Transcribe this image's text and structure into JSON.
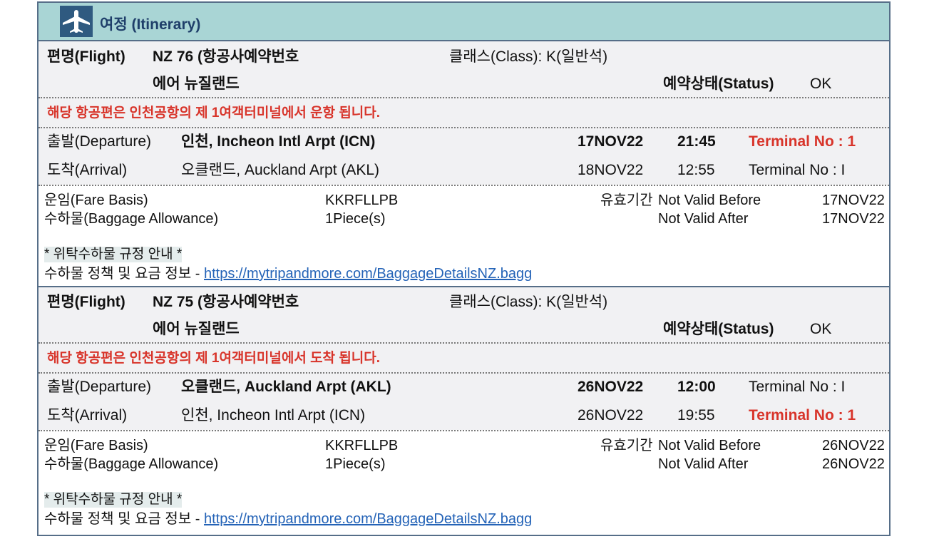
{
  "section": {
    "title": "여정 (Itinerary)",
    "icon": "airplane-icon"
  },
  "colors": {
    "accent": "#d8342a",
    "header_bg": "#a9d5d5",
    "border": "#566e88",
    "link": "#2463b7"
  },
  "labels": {
    "flight": "편명(Flight)",
    "class": "클래스(Class): K(일반석)",
    "status_label": "예약상태(Status)",
    "departure": "출발(Departure)",
    "arrival": "도착(Arrival)",
    "fare_basis": "운임(Fare Basis)",
    "baggage": "수하물(Baggage Allowance)",
    "validity": "유효기간",
    "not_valid_before": "Not Valid Before",
    "not_valid_after": "Not Valid After",
    "baggage_notice": "* 위탁수하물 규정 안내 *",
    "baggage_policy": "수하물 정책 및 요금 정보 -",
    "baggage_link": "https://mytripandmore.com/BaggageDetailsNZ.bagg"
  },
  "flights": [
    {
      "flight_no": "NZ 76 (항공사예약번호",
      "airline": "에어 뉴질랜드",
      "status": "OK",
      "notice": "해당 항공편은 인천공항의 제 1여객터미널에서 운항 됩니다.",
      "dep_airport": "인천, Incheon Intl Arpt (ICN)",
      "dep_date": "17NOV22",
      "dep_time": "21:45",
      "dep_terminal": "Terminal No : 1",
      "arr_airport": "오클랜드, Auckland Arpt (AKL)",
      "arr_date": "18NOV22",
      "arr_time": "12:55",
      "arr_terminal": "Terminal No : I",
      "fare_basis": "KKRFLLPB",
      "baggage": "1Piece(s)",
      "valid_before": "17NOV22",
      "valid_after": "17NOV22"
    },
    {
      "flight_no": "NZ 75 (항공사예약번호",
      "airline": "에어 뉴질랜드",
      "status": "OK",
      "notice": "해당 항공편은 인천공항의 제 1여객터미널에서 도착 됩니다.",
      "dep_airport": "오클랜드, Auckland Arpt (AKL)",
      "dep_date": "26NOV22",
      "dep_time": "12:00",
      "dep_terminal": "Terminal No : I",
      "arr_airport": "인천, Incheon Intl Arpt (ICN)",
      "arr_date": "26NOV22",
      "arr_time": "19:55",
      "arr_terminal": "Terminal No : 1",
      "fare_basis": "KKRFLLPB",
      "baggage": "1Piece(s)",
      "valid_before": "26NOV22",
      "valid_after": "26NOV22"
    }
  ]
}
